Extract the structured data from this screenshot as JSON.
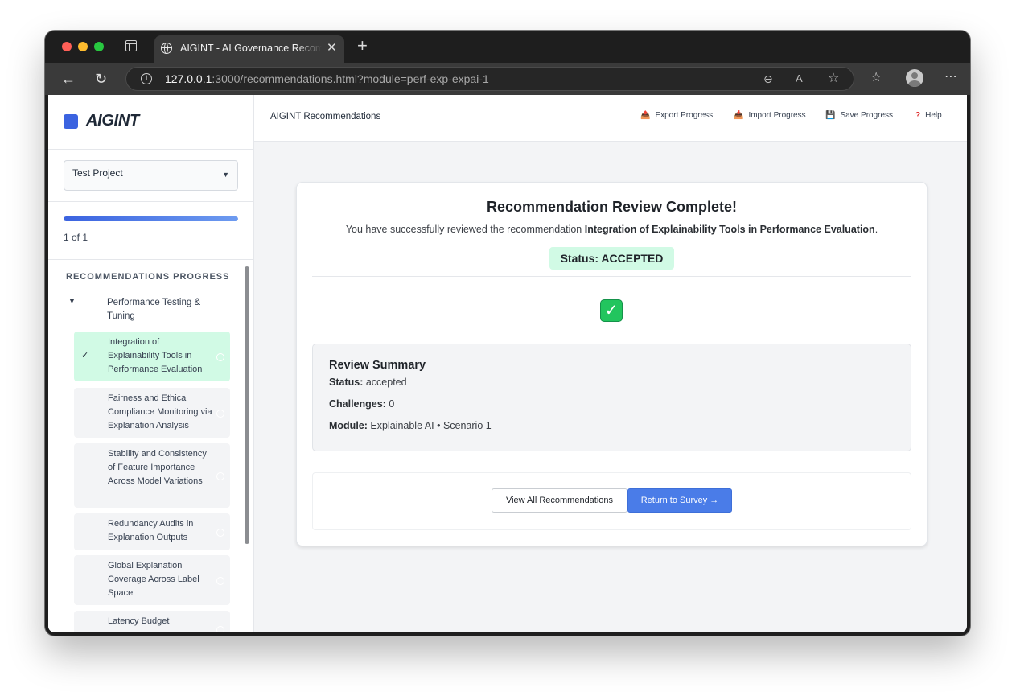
{
  "browser": {
    "tab_title": "AIGINT - AI Governance Recommendations",
    "url_host": "127.0.0.1",
    "url_rest": ":3000/recommendations.html?module=perf-exp-expai-1"
  },
  "sidebar": {
    "logo": "AIGINT",
    "project": "Test Project",
    "progress_text": "1 of 1",
    "progress_fraction": 1.0,
    "heading": "RECOMMENDATIONS PROGRESS",
    "group": "Performance Testing & Tuning",
    "items": [
      {
        "label": "Integration of Explainability Tools in Performance Evaluation",
        "check": "✓",
        "active": true
      },
      {
        "label": "Fairness and Ethical Compliance Monitoring via Explanation Analysis",
        "check": "",
        "active": false
      },
      {
        "label": "Stability and Consistency of Feature Importance Across Model Variations",
        "check": "",
        "active": false
      },
      {
        "label": "Redundancy Audits in Explanation Outputs",
        "check": "",
        "active": false
      },
      {
        "label": "Global Explanation Coverage Across Label Space",
        "check": "",
        "active": false
      },
      {
        "label": "Latency Budget",
        "check": "",
        "active": false
      }
    ]
  },
  "header": {
    "title": "AIGINT Recommendations",
    "export_label": "Export Progress",
    "import_label": "Import Progress",
    "save_label": "Save Progress",
    "help_label": "Help"
  },
  "card": {
    "title": "Recommendation Review Complete!",
    "desc_prefix": "You have successfully reviewed the recommendation ",
    "desc_name": "Integration of Explainability Tools in Performance Evaluation",
    "desc_suffix": ".",
    "status_pill": "Status: ACCEPTED",
    "summary": {
      "title": "Review Summary",
      "status_label": "Status:",
      "status_value": " accepted",
      "challenges_label": "Challenges:",
      "challenges_value": " 0",
      "module_label": "Module:",
      "module_value": " Explainable AI • Scenario 1"
    },
    "view_all_label": "View All Recommendations",
    "return_label": "Return to Survey →"
  },
  "colors": {
    "accent": "#4a7ce8",
    "success_bg": "#d1fae5",
    "logo": "#3b63e0"
  }
}
